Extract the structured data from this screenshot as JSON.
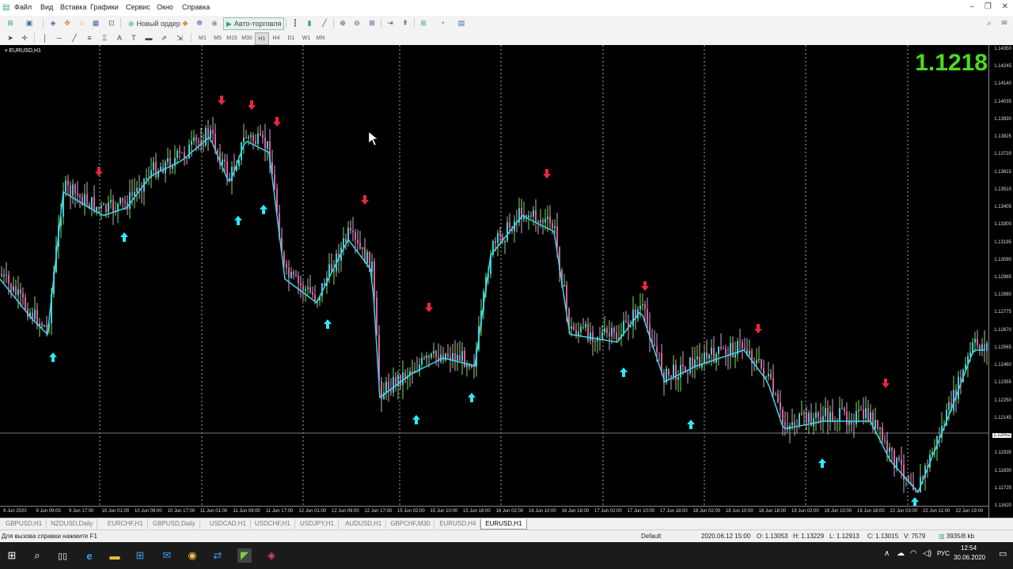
{
  "menu": [
    "Файл",
    "Вид",
    "Вставка",
    "Графики",
    "Сервис",
    "Окно",
    "Справка"
  ],
  "toolbar": {
    "new_order": "Новый ордер",
    "auto_trading": "Авто-торговля"
  },
  "timeframes": [
    "M1",
    "M5",
    "M15",
    "M30",
    "H1",
    "H4",
    "D1",
    "W1",
    "MN"
  ],
  "active_timeframe": "H1",
  "chart": {
    "symbol_label": "EURUSD,H1",
    "current_price": "1.1218",
    "current_price_color": "#4bdc1e",
    "price_ticks": [
      "1.14350",
      "1.14245",
      "1.14140",
      "1.14035",
      "1.13930",
      "1.13825",
      "1.13720",
      "1.13615",
      "1.13510",
      "1.13405",
      "1.13300",
      "1.13195",
      "1.13090",
      "1.12985",
      "1.12880",
      "1.12775",
      "1.12670",
      "1.12565",
      "1.12460",
      "1.12355",
      "1.12250",
      "1.12145",
      "1.12052",
      "1.11935",
      "1.11830",
      "1.11725",
      "1.11620"
    ],
    "highlighted_price": "1.12052",
    "time_ticks": [
      "9 Jun 2020",
      "9 Jun 09:00",
      "9 Jun 17:00",
      "10 Jun 01:00",
      "10 Jun 09:00",
      "10 Jun 17:00",
      "11 Jun 01:00",
      "11 Jun 09:00",
      "11 Jun 17:00",
      "12 Jun 01:00",
      "12 Jun 09:00",
      "12 Jun 17:00",
      "15 Jun 02:00",
      "15 Jun 10:00",
      "15 Jun 18:00",
      "16 Jun 02:00",
      "16 Jun 10:00",
      "16 Jun 18:00",
      "17 Jun 02:00",
      "17 Jun 10:00",
      "17 Jun 18:00",
      "18 Jun 02:00",
      "18 Jun 10:00",
      "18 Jun 18:00",
      "19 Jun 02:00",
      "19 Jun 10:00",
      "19 Jun 18:00",
      "22 Jun 03:00",
      "22 Jun 11:00",
      "22 Jun 19:00"
    ],
    "colors": {
      "bull_wick": "#7fe05a",
      "bear_wick": "#d8a8d8",
      "bull_box": "#3fd8e8",
      "bear_box": "#e860a0",
      "up_arrow": "#2ee8f8",
      "down_arrow": "#e8283c"
    }
  },
  "tabs": [
    "GBPUSD,H1",
    "NZDUSD,Daily",
    "EURCHF,H1",
    "GBPUSD,Daily",
    "USDCAD,H1",
    "USDCHF,H1",
    "USDJPY,H1",
    "AUDUSD,H1",
    "GBPCHF,M30",
    "EURUSD,H4",
    "EURUSD,H1"
  ],
  "active_tab": "EURUSD,H1",
  "status": {
    "help": "Для вызова справки нажмите F1",
    "profile": "Default",
    "datetime": "2020.06.12 15:00",
    "open": "O: 1.13053",
    "high": "H: 1.13229",
    "low": "L: 1.12913",
    "close": "C: 1.13015",
    "volume": "V: 7579",
    "traffic": "3935/8 kb"
  },
  "taskbar": {
    "lang": "РУС",
    "time": "12:54",
    "date": "30.06.2020"
  }
}
